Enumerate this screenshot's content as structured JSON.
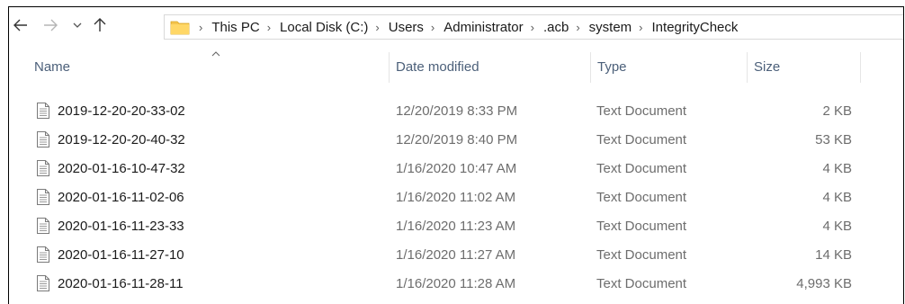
{
  "address": {
    "crumbs": [
      "This PC",
      "Local Disk (C:)",
      "Users",
      "Administrator",
      ".acb",
      "system",
      "IntegrityCheck"
    ]
  },
  "columns": {
    "name": "Name",
    "date": "Date modified",
    "type": "Type",
    "size": "Size"
  },
  "files": [
    {
      "name": "2019-12-20-20-33-02",
      "date": "12/20/2019 8:33 PM",
      "type": "Text Document",
      "size": "2 KB"
    },
    {
      "name": "2019-12-20-20-40-32",
      "date": "12/20/2019 8:40 PM",
      "type": "Text Document",
      "size": "53 KB"
    },
    {
      "name": "2020-01-16-10-47-32",
      "date": "1/16/2020 10:47 AM",
      "type": "Text Document",
      "size": "4 KB"
    },
    {
      "name": "2020-01-16-11-02-06",
      "date": "1/16/2020 11:02 AM",
      "type": "Text Document",
      "size": "4 KB"
    },
    {
      "name": "2020-01-16-11-23-33",
      "date": "1/16/2020 11:23 AM",
      "type": "Text Document",
      "size": "4 KB"
    },
    {
      "name": "2020-01-16-11-27-10",
      "date": "1/16/2020 11:27 AM",
      "type": "Text Document",
      "size": "14 KB"
    },
    {
      "name": "2020-01-16-11-28-11",
      "date": "1/16/2020 11:28 AM",
      "type": "Text Document",
      "size": "4,993 KB"
    }
  ],
  "icons": {
    "back": "back-arrow-icon",
    "forward": "forward-arrow-icon",
    "recent": "chevron-down-icon",
    "up": "up-arrow-icon",
    "folder": "folder-icon",
    "file": "text-document-icon"
  },
  "colors": {
    "folder": "#f4c44e",
    "header_text": "#4c607a",
    "meta_text": "#6d6d6d"
  }
}
